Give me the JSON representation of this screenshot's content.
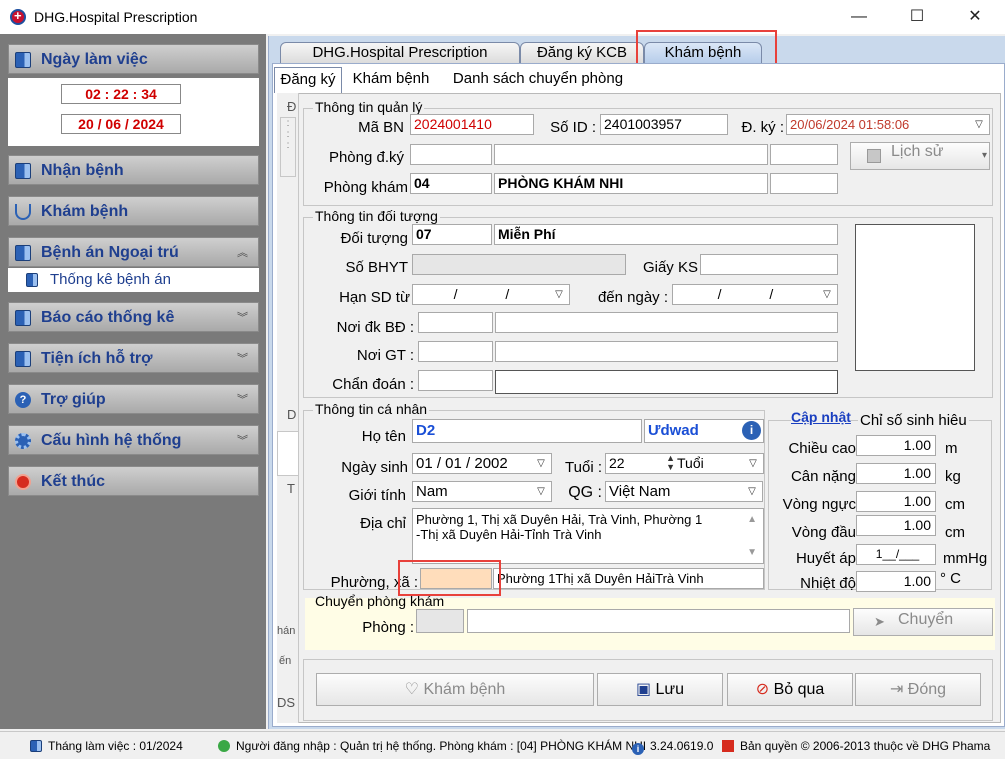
{
  "window": {
    "title": "DHG.Hospital Prescription",
    "minimize": "—",
    "maximize": "☐",
    "close": "✕"
  },
  "sidebar": {
    "workday": {
      "label": "Ngày làm việc",
      "time": "02 : 22 : 34",
      "date": "20 / 06 / 2024"
    },
    "items": [
      {
        "label": "Nhận bệnh"
      },
      {
        "label": "Khám bệnh"
      },
      {
        "label": "Bệnh án Ngoại trú"
      },
      {
        "label": "Báo cáo thống kê"
      },
      {
        "label": "Tiện ích hỗ trợ"
      },
      {
        "label": "Trợ giúp"
      },
      {
        "label": "Cấu hình hệ thống"
      },
      {
        "label": "Kết thúc"
      }
    ],
    "subitem": "Thống kê bệnh án"
  },
  "tabs": {
    "t1": "DHG.Hospital Prescription",
    "t2": "Đăng ký KCB",
    "t3": "Khám bệnh"
  },
  "subtabs": {
    "s1": "Đăng ký",
    "s2": "Khám bệnh",
    "s3": "Danh sách chuyển phòng"
  },
  "strip": {
    "a": "Đ",
    "b": "D",
    "c": "T",
    "d": "hán",
    "e": "ến",
    "f": "DS"
  },
  "mgmt": {
    "title": "Thông tin quản lý",
    "ma_bn_label": "Mã BN",
    "ma_bn": "2024001410",
    "so_id_label": "Số ID :",
    "so_id": "2401003957",
    "dky_label": "Đ. ký :",
    "dky": "20/06/2024 01:58:06",
    "phong_dky_label": "Phòng đ.ký",
    "phong_kham_label": "Phòng khám",
    "phong_kham_code": "04",
    "phong_kham_name": "PHÒNG KHÁM NHI",
    "history_btn": "Lịch sử"
  },
  "subject": {
    "title": "Thông tin đối tượng",
    "doi_tuong_label": "Đối tượng",
    "doi_tuong_code": "07",
    "doi_tuong_name": "Miễn Phí",
    "bhyt_label": "Số BHYT",
    "giay_ks_label": "Giấy KS",
    "hansd_label": "Hạn SD từ",
    "hansd_value": "/ /",
    "den_ngay_label": "đến ngày :",
    "den_ngay_value": "/ /",
    "noi_dk_label": "Nơi đk BĐ :",
    "noi_gt_label": "Nơi GT :",
    "chan_doan_label": "Chẩn đoán :"
  },
  "personal": {
    "title": "Thông tin cá nhân",
    "ho_ten_label": "Họ tên",
    "ho_ten": "D2",
    "ho_ten2": "Ưdwad",
    "ngay_sinh_label": "Ngày sinh",
    "ngay_sinh": "01 / 01 / 2002",
    "tuoi_label": "Tuổi :",
    "tuoi": "22",
    "tuoi_unit": "Tuổi",
    "gioi_tinh_label": "Giới tính",
    "gioi_tinh": "Nam",
    "qg_label": "QG :",
    "qg": "Việt Nam",
    "dia_chi_label": "Địa chỉ",
    "dia_chi_1": "Phường 1, Thị xã Duyên Hải, Trà Vinh, Phường 1",
    "dia_chi_2": "-Thị xã Duyên Hải-Tỉnh Trà Vinh",
    "phuong_label": "Phường, xã :",
    "phuong_value": "Phường 1Thị xã Duyên HảiTrà Vinh"
  },
  "vitals": {
    "update_link": "Cập nhật",
    "title": "Chỉ số sinh hiêu",
    "rows": [
      {
        "label": "Chiều cao",
        "value": "1.00",
        "unit": "m"
      },
      {
        "label": "Cân nặng",
        "value": "1.00",
        "unit": "kg"
      },
      {
        "label": "Vòng ngực",
        "value": "1.00",
        "unit": "cm"
      },
      {
        "label": "Vòng đầu",
        "value": "1.00",
        "unit": "cm"
      },
      {
        "label": "Huyết áp",
        "value": "1__/___",
        "unit": "mmHg"
      },
      {
        "label": "Nhiệt độ",
        "value": "1.00",
        "unit": "° C"
      }
    ]
  },
  "transfer": {
    "title": "Chuyển phòng khám",
    "phong_label": "Phòng :",
    "btn": "Chuyển"
  },
  "actions": {
    "kham": "Khám bệnh",
    "luu": "Lưu",
    "bo_qua": "Bỏ qua",
    "dong": "Đóng"
  },
  "status": {
    "month": "Tháng làm việc : 01/2024",
    "user": "Người đăng nhập : Quản trị hệ thống. Phòng khám : [04] PHÒNG KHÁM NHI",
    "version": "3.24.0619.0",
    "copyright": "Bản quyền © 2006-2013 thuộc về DHG Phama"
  }
}
